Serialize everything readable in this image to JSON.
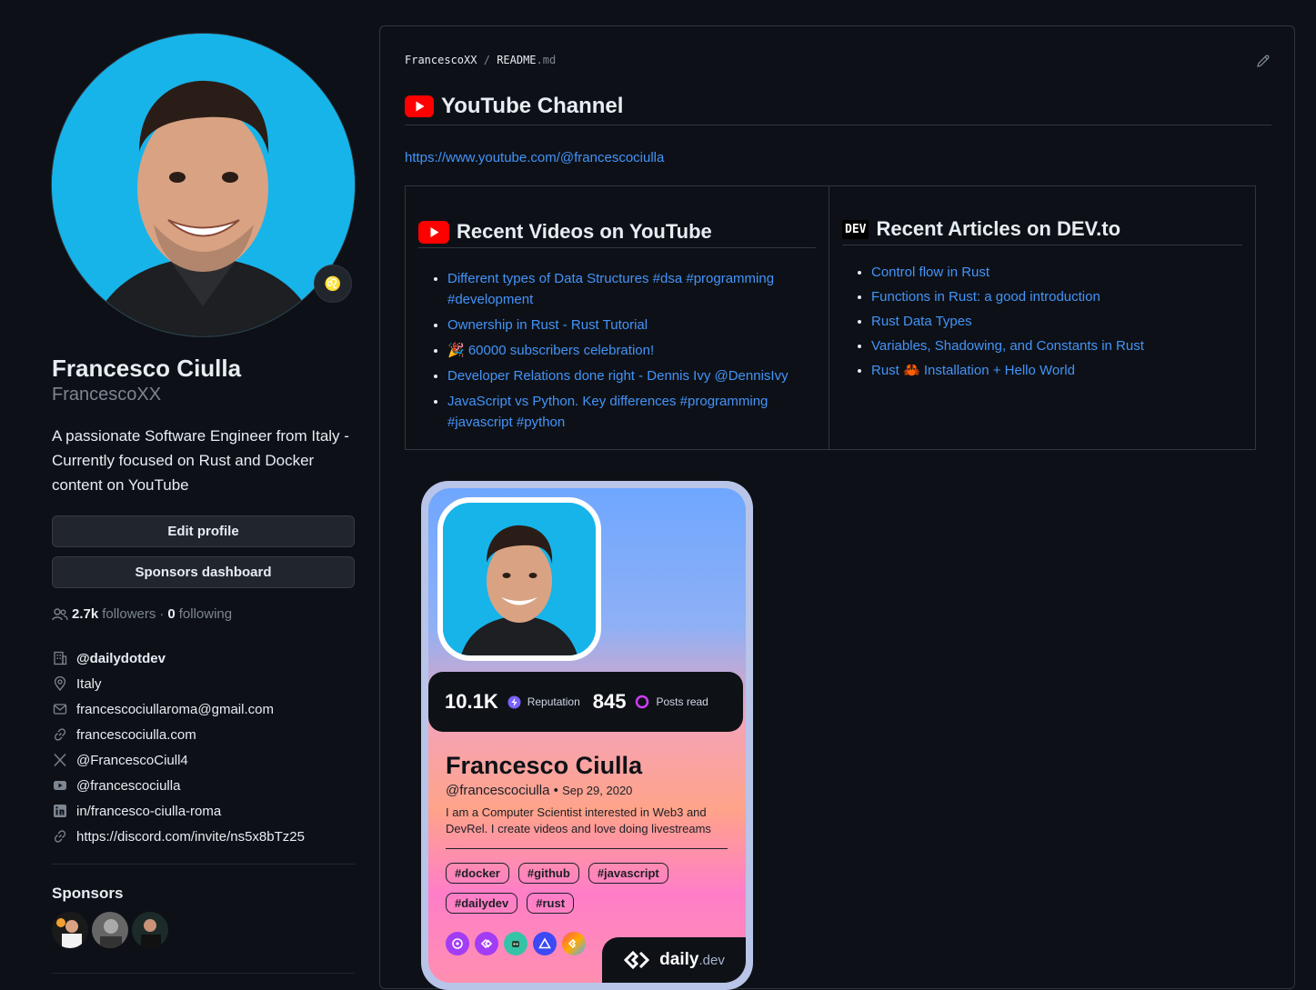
{
  "profile": {
    "name": "Francesco Ciulla",
    "username": "FrancescoXX",
    "bio": "A passionate Software Engineer from Italy - Currently focused on Rust and Docker content on YouTube",
    "edit_profile_label": "Edit profile",
    "sponsors_dashboard_label": "Sponsors dashboard",
    "followers_count": "2.7k",
    "followers_label": "followers",
    "separator": "·",
    "following_count": "0",
    "following_label": "following",
    "organization": "@dailydotdev",
    "location": "Italy",
    "email": "francescociullaroma@gmail.com",
    "website": "francescociulla.com",
    "x_handle": "@FrancescoCiull4",
    "youtube_handle": "@francescociulla",
    "linkedin": "in/francesco-ciulla-roma",
    "discord": "https://discord.com/invite/ns5x8bTz25",
    "sponsors_title": "Sponsors"
  },
  "readme": {
    "crumb_owner": "FrancescoXX",
    "crumb_sep": "/",
    "crumb_file": "README",
    "crumb_ext": ".md",
    "heading": "YouTube Channel",
    "youtube_url": "https://www.youtube.com/@francescociulla",
    "videos_heading": "Recent Videos on YouTube",
    "videos": [
      "Different types of Data Structures #dsa #programming #development",
      "Ownership in Rust - Rust Tutorial",
      "🎉 60000 subscribers celebration!",
      "Developer Relations done right - Dennis Ivy @DennisIvy",
      "JavaScript vs Python. Key differences #programming #javascript #python"
    ],
    "articles_heading": "Recent Articles on DEV.to",
    "dev_logo": "DEV",
    "articles": [
      "Control flow in Rust",
      "Functions in Rust: a good introduction",
      "Rust Data Types",
      "Variables, Shadowing, and Constants in Rust",
      "Rust 🦀 Installation + Hello World"
    ]
  },
  "devcard": {
    "reputation": "10.1K",
    "reputation_label": "Reputation",
    "posts_read": "845",
    "posts_read_label": "Posts read",
    "name": "Francesco Ciulla",
    "handle": "@francescociulla",
    "dot": "•",
    "joined": "Sep 29, 2020",
    "bio": "I am a Computer Scientist interested in Web3 and DevRel. I create videos and love doing livestreams",
    "tags": [
      "#docker",
      "#github",
      "#javascript",
      "#dailydev",
      "#rust"
    ],
    "brand_word": "daily",
    "brand_suffix": ".dev"
  },
  "colors": {
    "background": "#0d1117",
    "link": "#4493f8",
    "muted": "#7d8590",
    "avatar_bg": "#17b4ea",
    "youtube_red": "#ff0000"
  },
  "icons": [
    "people-icon",
    "organization-icon",
    "location-icon",
    "mail-icon",
    "link-icon",
    "x-logo-icon",
    "youtube-icon",
    "linkedin-icon",
    "pencil-icon",
    "dev-logo-icon",
    "daily-dev-logo-icon"
  ]
}
